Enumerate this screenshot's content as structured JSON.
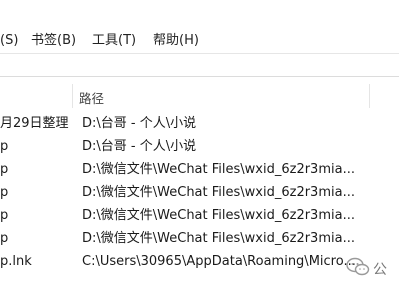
{
  "menubar": {
    "items": [
      {
        "label": "(S)"
      },
      {
        "label": "书签(B)"
      },
      {
        "label": "工具(T)"
      },
      {
        "label": "帮助(H)"
      }
    ]
  },
  "table": {
    "columns": [
      {
        "label": ""
      },
      {
        "label": "路径"
      }
    ],
    "rows": [
      {
        "name": "月29日整理",
        "path": "D:\\台哥 - 个人\\小说"
      },
      {
        "name": "p",
        "path": "D:\\台哥 - 个人\\小说"
      },
      {
        "name": "p",
        "path": "D:\\微信文件\\WeChat Files\\wxid_6z2r3mia..."
      },
      {
        "name": "p",
        "path": "D:\\微信文件\\WeChat Files\\wxid_6z2r3mia..."
      },
      {
        "name": "p",
        "path": "D:\\微信文件\\WeChat Files\\wxid_6z2r3mia..."
      },
      {
        "name": "p",
        "path": "D:\\微信文件\\WeChat Files\\wxid_6z2r3mia..."
      },
      {
        "name": "p.lnk",
        "path": "C:\\Users\\30965\\AppData\\Roaming\\Micro..."
      }
    ]
  },
  "watermark": {
    "text": "公",
    "icon": "wechat-icon"
  },
  "colors": {
    "menu_bg": "#ffffff",
    "header_divider": "#e5e5e5"
  }
}
